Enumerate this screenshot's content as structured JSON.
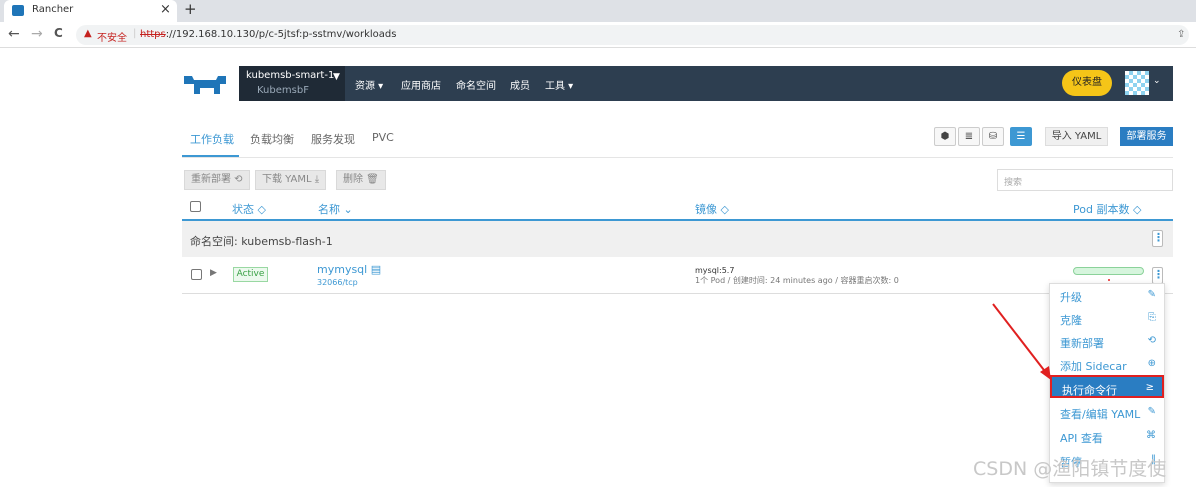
{
  "browser": {
    "tab_title": "Rancher",
    "tab_close": "×",
    "new_tab": "+",
    "back": "←",
    "forward": "→",
    "reload": "C",
    "insecure_label": "不安全",
    "url_scheme": "https",
    "url_rest": "://192.168.10.130/p/c-5jtsf:p-sstmv/workloads"
  },
  "header": {
    "cluster_name": "kubemsb-smart-1",
    "cluster_sub": "KubemsbF",
    "nav": [
      "资源 ▾",
      "应用商店",
      "命名空间",
      "成员",
      "工具 ▾"
    ],
    "dashboard_label": "仪表盘"
  },
  "subtabs": [
    "工作负载",
    "负载均衡",
    "服务发现",
    "PVC"
  ],
  "toolbar": {
    "import_yaml": "导入 YAML",
    "deploy": "部署服务"
  },
  "bulk_actions": [
    "重新部署 ⟲",
    "下载 YAML ⤓",
    "删除 🗑"
  ],
  "search": {
    "placeholder": "搜索"
  },
  "table": {
    "headers": [
      "状态 ◇",
      "名称 ⌄",
      "镜像 ◇",
      "Pod 副本数 ◇"
    ],
    "namespace_label": "命名空间: kubemsb-flash-1",
    "row": {
      "status": "Active",
      "name": "mymysql",
      "port": "32066/tcp",
      "image": "mysql:5.7",
      "image_sub": "1个 Pod / 创建时间: 24 minutes ago / 容器重启次数: 0",
      "pod_ready_fraction": 1.0
    }
  },
  "menu": [
    {
      "label": "升级",
      "icon": "✎"
    },
    {
      "label": "克隆",
      "icon": "⎘"
    },
    {
      "label": "重新部署",
      "icon": "⟲"
    },
    {
      "label": "添加 Sidecar",
      "icon": "⊕"
    },
    {
      "label": "执行命令行",
      "icon": "≥"
    },
    {
      "label": "查看/编辑 YAML",
      "icon": "✎"
    },
    {
      "label": "API 查看",
      "icon": "⌘"
    },
    {
      "label": "暂停",
      "icon": "‖"
    }
  ],
  "watermark": "CSDN @渔阳镇节度使",
  "colors": {
    "accent": "#3d98d3",
    "header_bg": "#2d3e50",
    "highlight_border": "#e02020"
  }
}
